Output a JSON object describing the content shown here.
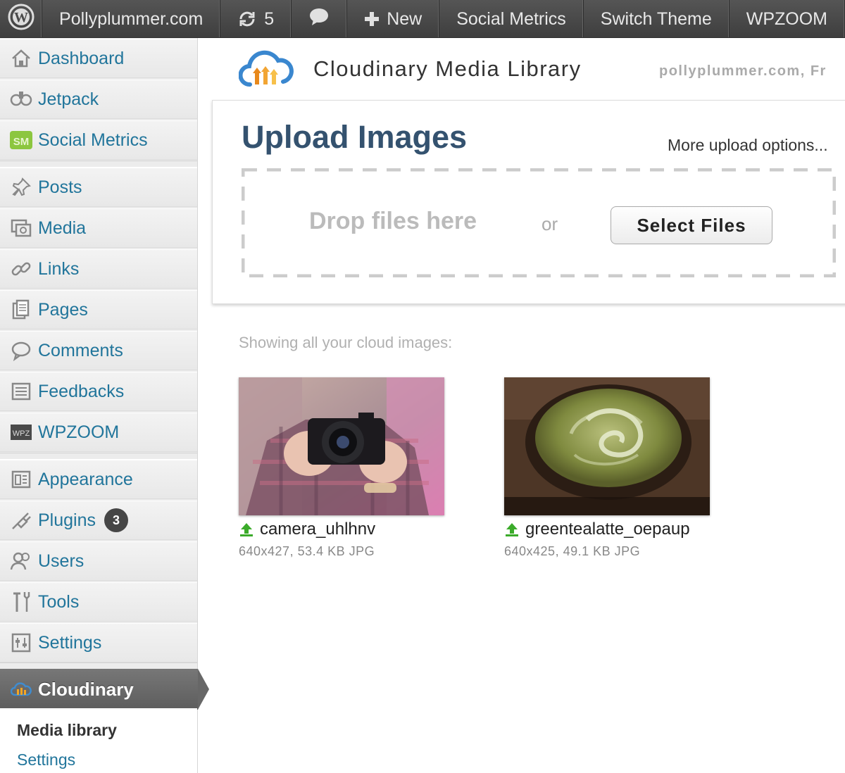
{
  "adminbar": {
    "site_name": "Pollyplummer.com",
    "updates_count": "5",
    "new_label": "New",
    "social_metrics": "Social Metrics",
    "switch_theme": "Switch Theme",
    "wpzoom": "WPZOOM"
  },
  "sidebar": {
    "items": [
      {
        "label": "Dashboard",
        "icon": "home-icon"
      },
      {
        "label": "Jetpack",
        "icon": "jetpack-icon"
      },
      {
        "label": "Social Metrics",
        "icon": "social-metrics-icon"
      },
      {
        "label": "Posts",
        "icon": "pin-icon"
      },
      {
        "label": "Media",
        "icon": "media-icon"
      },
      {
        "label": "Links",
        "icon": "link-icon"
      },
      {
        "label": "Pages",
        "icon": "pages-icon"
      },
      {
        "label": "Comments",
        "icon": "comment-icon"
      },
      {
        "label": "Feedbacks",
        "icon": "feedback-icon"
      },
      {
        "label": "WPZOOM",
        "icon": "wpzoom-icon"
      },
      {
        "label": "Appearance",
        "icon": "appearance-icon"
      },
      {
        "label": "Plugins",
        "icon": "plugin-icon",
        "badge": "3"
      },
      {
        "label": "Users",
        "icon": "users-icon"
      },
      {
        "label": "Tools",
        "icon": "tools-icon"
      },
      {
        "label": "Settings",
        "icon": "settings-icon"
      }
    ],
    "active": {
      "label": "Cloudinary",
      "icon": "cloudinary-icon"
    },
    "submenu": {
      "media_library": "Media library",
      "settings": "Settings"
    }
  },
  "header": {
    "title": "Cloudinary Media Library",
    "site": "pollyplummer.com, Fr"
  },
  "upload": {
    "title": "Upload Images",
    "more_options": "More upload options...",
    "drop_text": "Drop files here",
    "or_text": "or",
    "select_files": "Select Files"
  },
  "library": {
    "showing": "Showing all your cloud images:",
    "images": [
      {
        "name": "camera_uhlhnv",
        "meta": "640x427, 53.4 KB JPG"
      },
      {
        "name": "greentealatte_oepaup",
        "meta": "640x425, 49.1 KB JPG"
      }
    ]
  },
  "colors": {
    "link": "#21759b",
    "title": "#34526f",
    "adminbar": "#464646"
  }
}
